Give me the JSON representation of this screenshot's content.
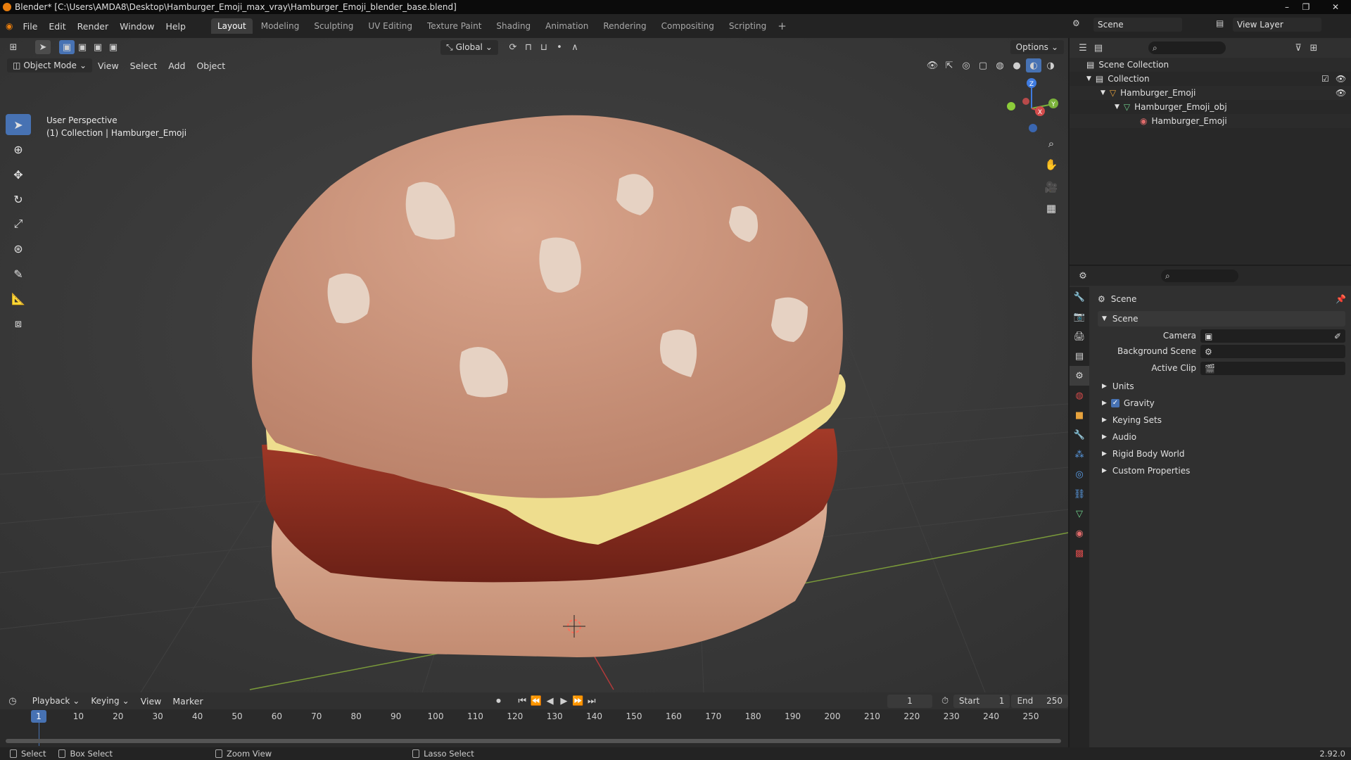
{
  "titlebar": {
    "title": "Blender* [C:\\Users\\AMDA8\\Desktop\\Hamburger_Emoji_max_vray\\Hamburger_Emoji_blender_base.blend]"
  },
  "menu": [
    "File",
    "Edit",
    "Render",
    "Window",
    "Help"
  ],
  "workspaces": [
    "Layout",
    "Modeling",
    "Sculpting",
    "UV Editing",
    "Texture Paint",
    "Shading",
    "Animation",
    "Rendering",
    "Compositing",
    "Scripting"
  ],
  "scene": {
    "name": "Scene",
    "view_layer": "View Layer"
  },
  "viewport": {
    "transform_orientation": "Global",
    "options_label": "Options",
    "mode": "Object Mode",
    "menus": [
      "View",
      "Select",
      "Add",
      "Object"
    ],
    "info_line1": "User Perspective",
    "info_line2": "(1) Collection | Hamburger_Emoji",
    "gizmo_axes": {
      "x": "X",
      "y": "Y",
      "z": "Z"
    }
  },
  "outliner": {
    "root": "Scene Collection",
    "items": [
      {
        "label": "Collection",
        "depth": 1
      },
      {
        "label": "Hamburger_Emoji",
        "depth": 2
      },
      {
        "label": "Hamburger_Emoji_obj",
        "depth": 3
      },
      {
        "label": "Hamburger_Emoji",
        "depth": 4
      }
    ]
  },
  "properties": {
    "context": "Scene",
    "panel": "Scene",
    "fields": {
      "camera": "Camera",
      "background_scene": "Background Scene",
      "active_clip": "Active Clip"
    },
    "subpanels": [
      "Units",
      "Gravity",
      "Keying Sets",
      "Audio",
      "Rigid Body World",
      "Custom Properties"
    ],
    "gravity_enabled": true
  },
  "timeline": {
    "menus": [
      "Playback",
      "Keying",
      "View",
      "Marker"
    ],
    "current_frame": "1",
    "start_label": "Start",
    "start": "1",
    "end_label": "End",
    "end": "250",
    "ticks": [
      "10",
      "20",
      "30",
      "40",
      "50",
      "60",
      "70",
      "80",
      "90",
      "100",
      "110",
      "120",
      "130",
      "140",
      "150",
      "160",
      "170",
      "180",
      "190",
      "200",
      "210",
      "220",
      "230",
      "240",
      "250"
    ],
    "playhead": "1"
  },
  "statusbar": {
    "select": "Select",
    "box_select": "Box Select",
    "zoom_view": "Zoom View",
    "lasso_select": "Lasso Select",
    "version": "2.92.0"
  },
  "colors": {
    "accent": "#4772b3",
    "bun": "#c9957d",
    "cheese": "#f0df8c",
    "patty": "#8c2e1f",
    "sesame": "#e6d2c3"
  }
}
